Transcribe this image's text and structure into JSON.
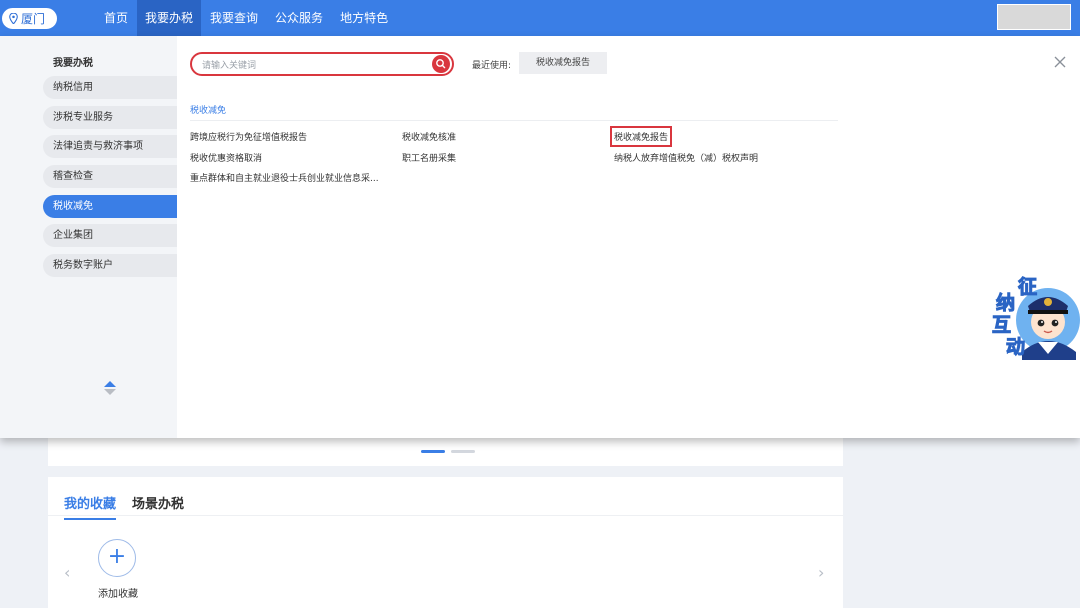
{
  "header": {
    "city": "厦门",
    "nav": [
      "首页",
      "我要办税",
      "我要查询",
      "公众服务",
      "地方特色"
    ],
    "active_nav": 1,
    "brand_color": "#3a7ee6"
  },
  "sidebar": {
    "title": "我要办税",
    "items": [
      "纳税信用",
      "涉税专业服务",
      "法律追责与救济事项",
      "稽查检查",
      "税收减免",
      "企业集团",
      "税务数字账户"
    ],
    "active_index": 4
  },
  "search": {
    "placeholder": "请输入关键词"
  },
  "recent": {
    "label": "最近使用:",
    "item": "税收减免报告"
  },
  "section": {
    "title": "税收减免",
    "links": [
      "跨境应税行为免征增值税报告",
      "税收减免核准",
      "税收减免报告",
      "税收优惠资格取消",
      "职工名册采集",
      "纳税人放弃增值税免（减）税权声明",
      "重点群体和自主就业退役士兵创业就业信息采..."
    ],
    "highlighted_index": 2,
    "highlight_color": "#d9363e"
  },
  "mascot": {
    "text": [
      "征",
      "纳",
      "互",
      "动"
    ]
  },
  "favorites": {
    "tabs": [
      "我的收藏",
      "场景办税"
    ],
    "active_tab": 0,
    "add_label": "添加收藏",
    "add_symbol": "+"
  }
}
